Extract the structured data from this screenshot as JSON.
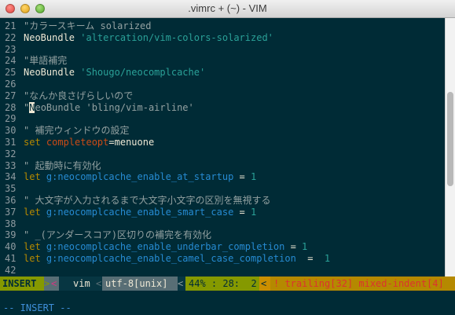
{
  "window": {
    "title": ".vimrc + (~) - VIM"
  },
  "colors": {
    "background": "#002b36",
    "comment": "#93a1a1",
    "keyword": "#b58900",
    "identifier": "#268bd2",
    "string": "#2aa198",
    "option": "#cb4b16",
    "plain": "#eee8d5",
    "number": "#2aa198",
    "line_number": "#8f9ba0",
    "mode_bg": "#859900",
    "warning": "#dc322f"
  },
  "editor": {
    "lines": [
      {
        "n": "21",
        "parts": [
          {
            "t": "\"カラースキーム solarized",
            "c": "comment"
          }
        ]
      },
      {
        "n": "22",
        "parts": [
          {
            "t": "NeoBundle ",
            "c": "plain"
          },
          {
            "t": "'altercation/vim-colors-solarized'",
            "c": "string"
          }
        ]
      },
      {
        "n": "23",
        "parts": []
      },
      {
        "n": "24",
        "parts": [
          {
            "t": "\"単語補完",
            "c": "comment"
          }
        ]
      },
      {
        "n": "25",
        "parts": [
          {
            "t": "NeoBundle ",
            "c": "plain"
          },
          {
            "t": "'Shougo/neocomplcache'",
            "c": "string"
          }
        ]
      },
      {
        "n": "26",
        "parts": []
      },
      {
        "n": "27",
        "parts": [
          {
            "t": "\"なんか良さげらしいので",
            "c": "comment"
          }
        ]
      },
      {
        "n": "28",
        "parts": [
          {
            "t": "\"",
            "c": "comment"
          },
          {
            "t": "N",
            "c": "cursor"
          },
          {
            "t": "eoBundle 'bling/vim-airline'",
            "c": "comment"
          }
        ]
      },
      {
        "n": "29",
        "parts": []
      },
      {
        "n": "30",
        "parts": [
          {
            "t": "\" 補完ウィンドウの設定",
            "c": "comment"
          }
        ]
      },
      {
        "n": "31",
        "parts": [
          {
            "t": "set ",
            "c": "keyword"
          },
          {
            "t": "completeopt",
            "c": "option"
          },
          {
            "t": "=menuone",
            "c": "plain"
          }
        ]
      },
      {
        "n": "32",
        "parts": []
      },
      {
        "n": "33",
        "parts": [
          {
            "t": "\" 起動時に有効化",
            "c": "comment"
          }
        ]
      },
      {
        "n": "34",
        "parts": [
          {
            "t": "let ",
            "c": "keyword"
          },
          {
            "t": "g:neocomplcache_enable_at_startup",
            "c": "identifier"
          },
          {
            "t": " = ",
            "c": "plain"
          },
          {
            "t": "1",
            "c": "number"
          }
        ]
      },
      {
        "n": "35",
        "parts": []
      },
      {
        "n": "36",
        "parts": [
          {
            "t": "\" 大文字が入力されるまで大文字小文字の区別を無視する",
            "c": "comment"
          }
        ]
      },
      {
        "n": "37",
        "parts": [
          {
            "t": "let ",
            "c": "keyword"
          },
          {
            "t": "g:neocomplcache_enable_smart_case",
            "c": "identifier"
          },
          {
            "t": " = ",
            "c": "plain"
          },
          {
            "t": "1",
            "c": "number"
          }
        ]
      },
      {
        "n": "38",
        "parts": []
      },
      {
        "n": "39",
        "parts": [
          {
            "t": "\" _(アンダースコア)区切りの補完を有効化",
            "c": "comment"
          }
        ]
      },
      {
        "n": "40",
        "parts": [
          {
            "t": "let ",
            "c": "keyword"
          },
          {
            "t": "g:neocomplcache_enable_underbar_completion",
            "c": "identifier"
          },
          {
            "t": " = ",
            "c": "plain"
          },
          {
            "t": "1",
            "c": "number"
          }
        ]
      },
      {
        "n": "41",
        "parts": [
          {
            "t": "let ",
            "c": "keyword"
          },
          {
            "t": "g:neocomplcache_enable_camel_case_completion",
            "c": "identifier"
          },
          {
            "t": "  =  ",
            "c": "plain"
          },
          {
            "t": "1",
            "c": "number"
          }
        ]
      },
      {
        "n": "42",
        "parts": []
      }
    ]
  },
  "statusline": {
    "mode": "INSERT",
    "sep1": ">",
    "sep2": "<",
    "filename": "vim",
    "sep3": "<",
    "encoding": "utf-8[unix]",
    "sep4": "<",
    "position": "44% : 28:  2",
    "sep5": "<",
    "warnings": "! trailing[32] mixed-indent[4]"
  },
  "cmdline": {
    "text": "-- INSERT --"
  }
}
